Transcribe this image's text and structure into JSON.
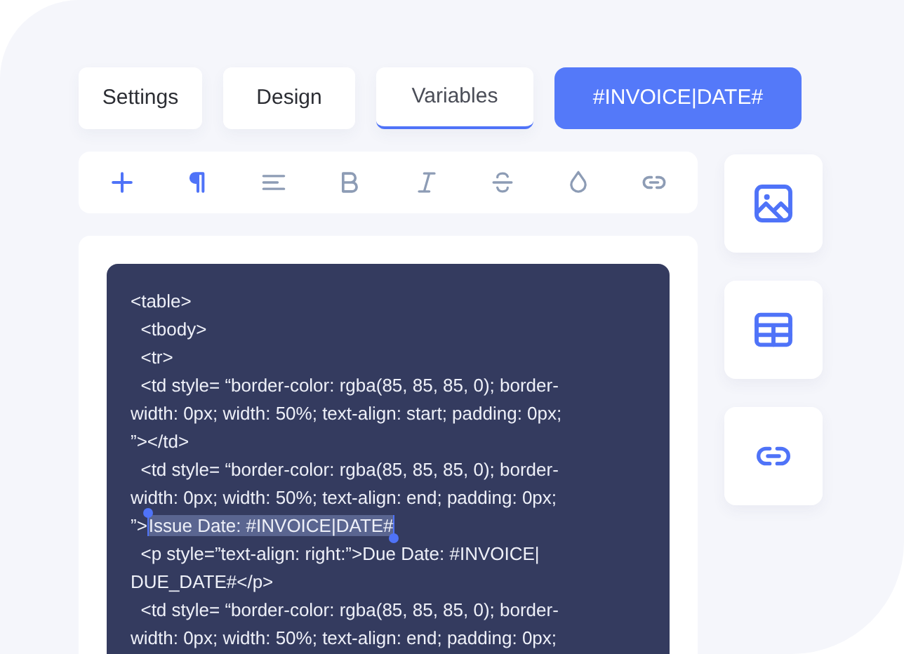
{
  "tabs": [
    {
      "label": "Settings",
      "selected": false
    },
    {
      "label": "Design",
      "selected": false
    },
    {
      "label": "Variables",
      "selected": true
    }
  ],
  "token_button": {
    "label": "#INVOICE|DATE#"
  },
  "toolbar": [
    {
      "kind": "plus",
      "active": true
    },
    {
      "kind": "paragraph",
      "active": true
    },
    {
      "kind": "align",
      "active": false
    },
    {
      "kind": "bold",
      "active": false
    },
    {
      "kind": "italic",
      "active": false
    },
    {
      "kind": "strike",
      "active": false
    },
    {
      "kind": "drop",
      "active": false
    },
    {
      "kind": "link",
      "active": false
    }
  ],
  "side_buttons": [
    {
      "kind": "image"
    },
    {
      "kind": "table"
    },
    {
      "kind": "link"
    }
  ],
  "code_lines": [
    [
      {
        "text": "<table>",
        "selected": false
      }
    ],
    [
      {
        "text": "  <tbody>",
        "selected": false
      }
    ],
    [
      {
        "text": "  <tr>",
        "selected": false
      }
    ],
    [
      {
        "text": "  <td style= “border-color: rgba(85, 85, 85, 0); border-",
        "selected": false
      }
    ],
    [
      {
        "text": "width: 0px; width: 50%; text-align: start; padding: 0px;",
        "selected": false
      }
    ],
    [
      {
        "text": "”></td>",
        "selected": false
      }
    ],
    [
      {
        "text": "  <td style= “border-color: rgba(85, 85, 85, 0); border-",
        "selected": false
      }
    ],
    [
      {
        "text": "width: 0px; width: 50%; text-align: end; padding: 0px;",
        "selected": false
      }
    ],
    [
      {
        "text": "”>",
        "selected": false
      },
      {
        "text": "Issue Date: #INVOICE|DATE#",
        "selected": true
      }
    ],
    [
      {
        "text": "  <p style=”text-align: right:”>Due Date: #INVOICE|",
        "selected": false
      }
    ],
    [
      {
        "text": "DUE_DATE#</p>",
        "selected": false
      }
    ],
    [
      {
        "text": "  <td style= “border-color: rgba(85, 85, 85, 0); border-",
        "selected": false
      }
    ],
    [
      {
        "text": "width: 0px; width: 50%; text-align: end; padding: 0px;",
        "selected": false
      }
    ]
  ]
}
